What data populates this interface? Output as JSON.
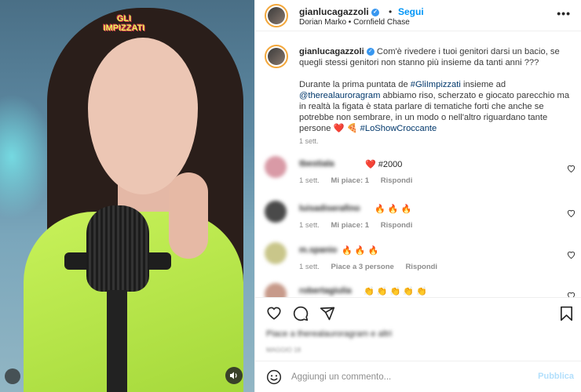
{
  "media": {
    "logo_text": "GLI IMPIZZATI",
    "icons": {
      "audio": "volume-icon",
      "bottom": "grid-icon"
    }
  },
  "header": {
    "username": "gianlucagazzoli",
    "separator": "•",
    "follow_label": "Segui",
    "subtitle": "Dorian Marko • Cornfield Chase",
    "more_label": "•••",
    "icons": {
      "verified": "verified-badge-icon",
      "more": "more-options-icon"
    }
  },
  "caption": {
    "username": "gianlucagazzoli",
    "line1": "Com'è rivedere i tuoi genitori darsi un bacio, se quegli stessi genitori non stanno più insieme da tanti anni ???",
    "para_prefix": "Durante la prima puntata de ",
    "hashtag1": "#GliImpizzati",
    "para_mid1": " insieme ad ",
    "mention": "@therealauroragram",
    "para_mid2": " abbiamo riso, scherzato e giocato parecchio ma in realtà la figata è stata parlare di tematiche forti che anche se potrebbe non sembrare, in un modo o nell'altro riguardano tante persone ❤️ 🍕 ",
    "hashtag2": "#LoShowCroccante",
    "time": "1 sett."
  },
  "comments": [
    {
      "name": "tbestiala",
      "text": "❤️ #2000",
      "time": "1 sett.",
      "likes": "Mi piace: 1",
      "reply": "Rispondi",
      "avatar_color": "#d99aa6"
    },
    {
      "name": "luisadiserafino",
      "text": "🔥 🔥 🔥",
      "time": "1 sett.",
      "likes": "Mi piace: 1",
      "reply": "Rispondi",
      "avatar_color": "#4a4a4a"
    },
    {
      "name": "m.spanio",
      "text": "🔥 🔥 🔥",
      "time": "1 sett.",
      "likes": "Piace a 3 persone",
      "reply": "Rispondi",
      "avatar_color": "#c9c68a"
    },
    {
      "name": "robertagiulia",
      "text": "👏 👏 👏 👏 👏",
      "time": "",
      "likes": "",
      "reply": "",
      "avatar_color": "#c79a8a"
    }
  ],
  "actions": {
    "icons": [
      "heart-icon",
      "comment-icon",
      "share-icon",
      "save-icon"
    ],
    "likes_text": "Piace a therealauroragram e altri",
    "date_text": "MAGGIO 18"
  },
  "add_comment": {
    "placeholder": "Aggiungi un commento...",
    "publish_label": "Pubblica",
    "icon": "emoji-icon"
  },
  "colors": {
    "accent_blue": "#0095f6",
    "link_blue": "#00376b",
    "muted": "#8e8e8e",
    "text": "#262626",
    "publish_disabled": "#b2dffc"
  }
}
